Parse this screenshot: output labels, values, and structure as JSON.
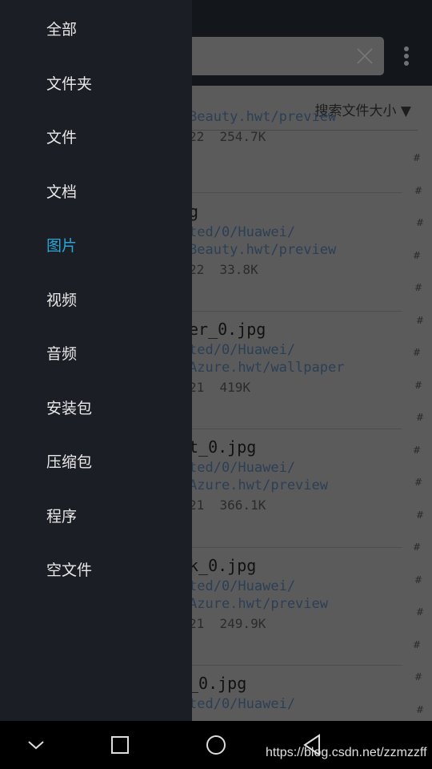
{
  "search": {
    "clear_icon": "close-icon",
    "more_icon": "more-vert-icon"
  },
  "sort": {
    "label": "搜索文件大小 ▼"
  },
  "rows": [
    {
      "name": "",
      "path1": "",
      "path2": "Beauty.hwt/preview",
      "meta": "22  254.7K"
    },
    {
      "name": "g",
      "path1": "ted/0/Huawei/",
      "path2": "Beauty.hwt/preview",
      "meta": "22  33.8K"
    },
    {
      "name": "er_0.jpg",
      "path1": "ted/0/Huawei/",
      "path2": "Azure.hwt/wallpaper",
      "meta": "21  419K"
    },
    {
      "name": "t_0.jpg",
      "path1": "ted/0/Huawei/",
      "path2": "Azure.hwt/preview",
      "meta": "21  366.1K"
    },
    {
      "name": "k_0.jpg",
      "path1": "ted/0/Huawei/",
      "path2": "Azure.hwt/preview",
      "meta": "21  249.9K"
    },
    {
      "name": "_0.jpg",
      "path1": "ted/0/Huawei/",
      "path2": "",
      "meta": ""
    }
  ],
  "hash_mark": "#",
  "drawer": {
    "selected": "图片",
    "selected_color": "#2aa7d6",
    "items": [
      "全部",
      "文件夹",
      "文件",
      "文档",
      "图片",
      "视频",
      "音频",
      "安装包",
      "压缩包",
      "程序",
      "空文件"
    ]
  },
  "nav": {
    "icons": [
      "chevron-down-icon",
      "recents-square-icon",
      "home-circle-icon",
      "back-triangle-icon"
    ]
  },
  "watermark": "https://blog.csdn.net/zzmzzff"
}
